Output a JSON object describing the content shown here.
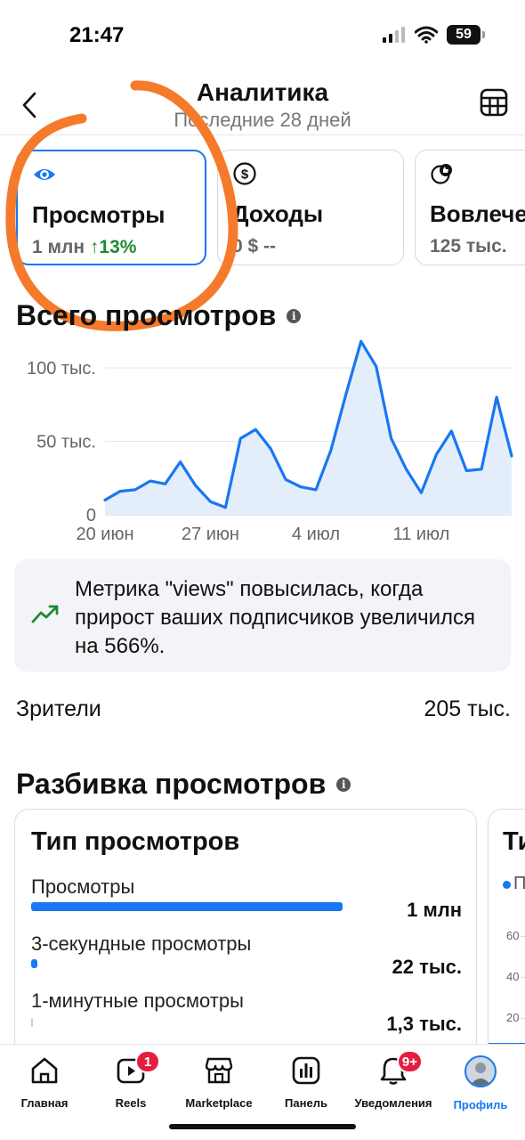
{
  "status_bar": {
    "time": "21:47",
    "battery": "59"
  },
  "header": {
    "title": "Аналитика",
    "subtitle": "Последние 28 дней"
  },
  "metric_cards": [
    {
      "label": "Просмотры",
      "value": "1 млн",
      "change": "↑13%",
      "icon": "eye-icon",
      "active": true
    },
    {
      "label": "Доходы",
      "value": "0 $ --",
      "icon": "dollar-icon",
      "active": false
    },
    {
      "label": "Вовлечен",
      "value": "125 тыс.",
      "icon": "engagement-icon",
      "active": false
    }
  ],
  "views_section": {
    "title": "Всего просмотров"
  },
  "chart_data": {
    "type": "area",
    "x_tick_labels": [
      "20 июн",
      "27 июн",
      "4 июл",
      "11 июл"
    ],
    "y_tick_labels": [
      "0",
      "50 тыс.",
      "100 тыс."
    ],
    "ylim": [
      0,
      120000
    ],
    "series": [
      {
        "values": [
          10000,
          16000,
          17000,
          23000,
          21000,
          36000,
          20000,
          9000,
          5000,
          52000,
          58000,
          45000,
          24000,
          19000,
          17000,
          44000,
          82000,
          118000,
          101000,
          52000,
          31000,
          15000,
          41000,
          57000,
          30000,
          31000,
          80000,
          40000
        ]
      }
    ],
    "grid": true,
    "color": "#1877f2"
  },
  "insight": {
    "text": "Метрика \"views\" повысилась, когда прирост ваших подписчиков увеличился на 566%.",
    "icon": "trending-up-icon"
  },
  "viewers": {
    "label": "Зрители",
    "value": "205 тыс."
  },
  "breakdown_section": {
    "title": "Разбивка просмотров",
    "card1": {
      "title": "Тип просмотров",
      "rows": [
        {
          "label": "Просмотры",
          "value": "1 млн",
          "fraction": 1.0
        },
        {
          "label": "3-секундные просмотры",
          "value": "22 тыс.",
          "fraction": 0.02
        },
        {
          "label": "1-минутные просмотры",
          "value": "1,3 тыс.",
          "fraction": 0.002
        }
      ]
    },
    "card2": {
      "title": "Ти",
      "legend": "П",
      "ticks": [
        "60",
        "40",
        "20"
      ]
    }
  },
  "tabbar": [
    {
      "label": "Главная",
      "icon": "home-icon"
    },
    {
      "label": "Reels",
      "icon": "reels-icon",
      "badge": "1"
    },
    {
      "label": "Marketplace",
      "icon": "marketplace-icon"
    },
    {
      "label": "Панель",
      "icon": "dashboard-icon"
    },
    {
      "label": "Уведомления",
      "icon": "notifications-icon",
      "badge": "9+"
    },
    {
      "label": "Профиль",
      "icon": "profile-avatar",
      "active": true
    }
  ],
  "colors": {
    "accent": "#1877f2",
    "positive": "#1f8a32",
    "annotation": "#f57a2c",
    "badge": "#e41e3f"
  }
}
